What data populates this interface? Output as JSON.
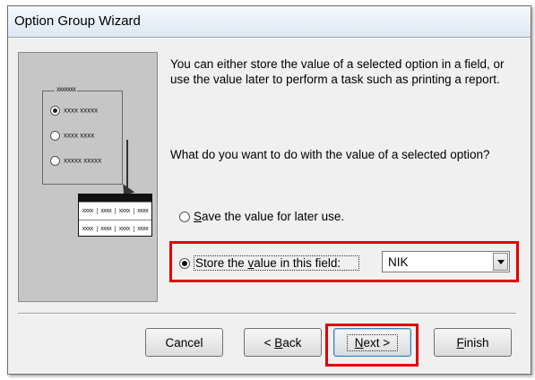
{
  "window": {
    "title": "Option Group Wizard"
  },
  "illustration": {
    "caption": "xxxxxxx",
    "options": [
      "xxxx xxxxx",
      "xxxx xxxx",
      "xxxxx xxxxx"
    ],
    "table_rows": [
      [
        "xxxx",
        "xxxx",
        "xxxx",
        "xxxx"
      ],
      [
        "xxxx",
        "xxxx",
        "xxxx",
        "xxxx"
      ]
    ]
  },
  "content": {
    "description": "You can either store the value of a selected option in a field, or use the value later to perform a task such as printing a report.",
    "question": "What do you want to do with the value of a selected option?"
  },
  "options": {
    "save": {
      "pre": "",
      "key": "S",
      "post": "ave the value for later use.",
      "selected": false
    },
    "store": {
      "pre": "Store the ",
      "key": "v",
      "post": "alue in this field:",
      "selected": true
    }
  },
  "field_combo": {
    "value": "NIK"
  },
  "buttons": {
    "cancel": {
      "label": "Cancel"
    },
    "back": {
      "pre": "< ",
      "key": "B",
      "post": "ack"
    },
    "next": {
      "pre": "",
      "key": "N",
      "post": "ext >"
    },
    "finish": {
      "pre": "",
      "key": "F",
      "post": "inish"
    }
  },
  "colors": {
    "highlight": "#e00000",
    "dialog_bg": "#f0f0f0",
    "illustration_bg": "#c6c6c6"
  }
}
